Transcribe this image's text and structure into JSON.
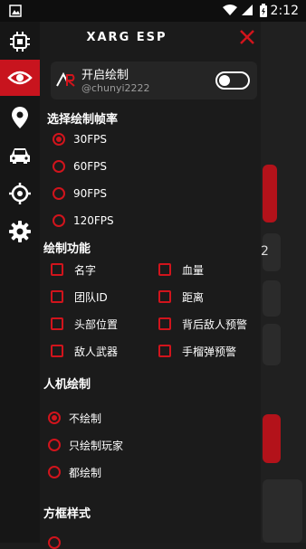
{
  "status": {
    "time": "2:12"
  },
  "app": {
    "title": "XARG ESP"
  },
  "user": {
    "title": "开启绘制",
    "handle": "@chunyi2222",
    "toggle_on": false
  },
  "sections": {
    "fps": "选择绘制帧率",
    "draw": "绘制功能",
    "bot": "人机绘制",
    "box": "方框样式"
  },
  "fps_options": [
    "30FPS",
    "60FPS",
    "90FPS",
    "120FPS"
  ],
  "fps_selected": "30FPS",
  "draw_features": [
    "名字",
    "血量",
    "团队ID",
    "距离",
    "头部位置",
    "背后敌人预警",
    "敌人武器",
    "手榴弹预警"
  ],
  "bot_options": [
    "不绘制",
    "只绘制玩家",
    "都绘制"
  ],
  "bot_selected": "不绘制",
  "background_fragment": "2",
  "sidebar_icons": [
    "chip-icon",
    "eye-icon",
    "location-pin-icon",
    "car-icon",
    "crosshair-icon",
    "gear-icon"
  ],
  "colors": {
    "accent": "#d1141c",
    "active_tab": "#c8141e",
    "panel": "#1b1b1b"
  }
}
